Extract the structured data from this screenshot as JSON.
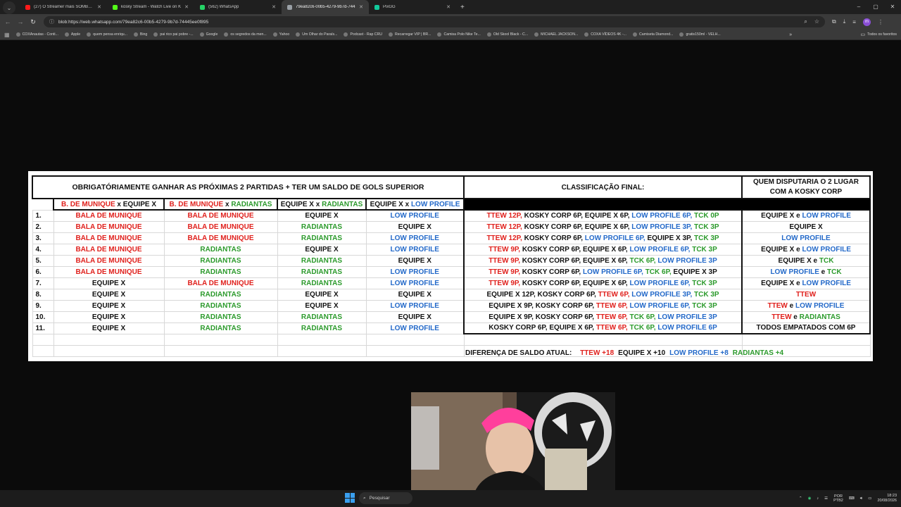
{
  "browser": {
    "tabs": [
      {
        "title": "(27) O Streamer mais SOMBRIO",
        "favicon_color": "#ff1a1a"
      },
      {
        "title": "kosky Stream - Watch Live on K",
        "favicon_color": "#53fc18"
      },
      {
        "title": "(562) WhatsApp",
        "favicon_color": "#25d366"
      },
      {
        "title": "79ea82c6-00b5-4279-9b7d-744",
        "favicon_color": "#9aa0a6",
        "active": true
      },
      {
        "title": "PixGG",
        "favicon_color": "#12c99b"
      }
    ],
    "address": "blob:https://web.whatsapp.com/79ea82c6-00b5-4279-9b7d-74445ee0f895",
    "profile_initial": "m",
    "bookmarks": [
      "COXAnautas - Conti...",
      "Apple",
      "quem pensa enriqu...",
      "Bing",
      "pai rico pai pobre -...",
      "Google",
      "os segredos da men...",
      "Yahoo",
      "Um Olhar do Paraís...",
      "Podcast - Rap CRU",
      "Recarregar VIP | BR...",
      "Camisa Polo Nike Te...",
      "Old Skool Black - C...",
      "MICHAEL JACKSON...",
      "COXA VÍDEOS 4K -...",
      "Camiseta Diamond...",
      "gratis150ml - VELH..."
    ],
    "all_bookmarks_label": "Todos os favoritos"
  },
  "sheet": {
    "header_main": "OBRIGATÓRIAMENTE GANHAR AS PRÓXIMAS 2 PARTIDAS + TER UM SALDO DE GOLS SUPERIOR",
    "header_class": "CLASSIFICAÇÃO FINAL:",
    "header_quem_line1": "QUEM DISPUTARIA O 2 LUGAR",
    "header_quem_line2": "COM A KOSKY CORP",
    "sub": [
      [
        {
          "t": "B. DE MUNIQUE",
          "c": "red"
        },
        {
          "t": " x ",
          "c": "blk"
        },
        {
          "t": "EQUIPE X",
          "c": "blk"
        }
      ],
      [
        {
          "t": "B. DE MUNIQUE",
          "c": "red"
        },
        {
          "t": " x ",
          "c": "blk"
        },
        {
          "t": "RADIANTAS",
          "c": "green"
        }
      ],
      [
        {
          "t": "EQUIPE X",
          "c": "blk"
        },
        {
          "t": " x ",
          "c": "blk"
        },
        {
          "t": "RADIANTAS",
          "c": "green"
        }
      ],
      [
        {
          "t": "EQUIPE X",
          "c": "blk"
        },
        {
          "t": " x ",
          "c": "blk"
        },
        {
          "t": "LOW PROFILE",
          "c": "blue"
        }
      ]
    ],
    "rows": [
      {
        "n": "1.",
        "m": [
          [
            "BALA DE MUNIQUE",
            "red"
          ],
          [
            "BALA DE MUNIQUE",
            "red"
          ],
          [
            "EQUIPE X",
            "blk"
          ],
          [
            "LOW PROFILE",
            "blue"
          ]
        ],
        "cls": [
          [
            "TTEW 12P,",
            "red"
          ],
          [
            " KOSKY CORP 6P, EQUIPE X 6P, ",
            "blk"
          ],
          [
            "LOW PROFILE 6P, ",
            "blue"
          ],
          [
            "TCK 0P",
            "green"
          ]
        ],
        "quem": [
          [
            "EQUIPE X ",
            "blk"
          ],
          [
            "e ",
            "blk"
          ],
          [
            "LOW PROFILE",
            "blue"
          ]
        ]
      },
      {
        "n": "2.",
        "m": [
          [
            "BALA DE MUNIQUE",
            "red"
          ],
          [
            "BALA DE MUNIQUE",
            "red"
          ],
          [
            "RADIANTAS",
            "green"
          ],
          [
            "EQUIPE X",
            "blk"
          ]
        ],
        "cls": [
          [
            "TTEW 12P,",
            "red"
          ],
          [
            " KOSKY CORP 6P, EQUIPE X 6P, ",
            "blk"
          ],
          [
            "LOW PROFILE 3P, ",
            "blue"
          ],
          [
            "TCK 3P",
            "green"
          ]
        ],
        "quem": [
          [
            "EQUIPE X",
            "blk"
          ]
        ]
      },
      {
        "n": "3.",
        "m": [
          [
            "BALA DE MUNIQUE",
            "red"
          ],
          [
            "BALA DE MUNIQUE",
            "red"
          ],
          [
            "RADIANTAS",
            "green"
          ],
          [
            "LOW PROFILE",
            "blue"
          ]
        ],
        "cls": [
          [
            "TTEW 12P,",
            "red"
          ],
          [
            " KOSKY CORP 6P, ",
            "blk"
          ],
          [
            "LOW PROFILE 6P,",
            "blue"
          ],
          [
            " EQUIPE X 3P, ",
            "blk"
          ],
          [
            "TCK 3P",
            "green"
          ]
        ],
        "quem": [
          [
            "LOW PROFILE",
            "blue"
          ]
        ]
      },
      {
        "n": "4.",
        "m": [
          [
            "BALA DE MUNIQUE",
            "red"
          ],
          [
            "RADIANTAS",
            "green"
          ],
          [
            "EQUIPE X",
            "blk"
          ],
          [
            "LOW PROFILE",
            "blue"
          ]
        ],
        "cls": [
          [
            "TTEW 9P,",
            "red"
          ],
          [
            " KOSKY CORP 6P, EQUIPE X 6P, ",
            "blk"
          ],
          [
            "LOW PROFILE 6P, ",
            "blue"
          ],
          [
            "TCK 3P",
            "green"
          ]
        ],
        "quem": [
          [
            "EQUIPE X ",
            "blk"
          ],
          [
            "e ",
            "blk"
          ],
          [
            "LOW PROFILE",
            "blue"
          ]
        ]
      },
      {
        "n": "5.",
        "m": [
          [
            "BALA DE MUNIQUE",
            "red"
          ],
          [
            "RADIANTAS",
            "green"
          ],
          [
            "RADIANTAS",
            "green"
          ],
          [
            "EQUIPE X",
            "blk"
          ]
        ],
        "cls": [
          [
            "TTEW 9P,",
            "red"
          ],
          [
            " KOSKY CORP 6P, EQUIPE X 6P, ",
            "blk"
          ],
          [
            "TCK 6P, ",
            "green"
          ],
          [
            "LOW PROFILE 3P",
            "blue"
          ]
        ],
        "quem": [
          [
            "EQUIPE X ",
            "blk"
          ],
          [
            "e ",
            "blk"
          ],
          [
            "TCK",
            "green"
          ]
        ]
      },
      {
        "n": "6.",
        "m": [
          [
            "BALA DE MUNIQUE",
            "red"
          ],
          [
            "RADIANTAS",
            "green"
          ],
          [
            "RADIANTAS",
            "green"
          ],
          [
            "LOW PROFILE",
            "blue"
          ]
        ],
        "cls": [
          [
            "TTEW 9P,",
            "red"
          ],
          [
            " KOSKY CORP 6P, ",
            "blk"
          ],
          [
            "LOW PROFILE 6P, ",
            "blue"
          ],
          [
            "TCK 6P,",
            "green"
          ],
          [
            " EQUIPE X 3P",
            "blk"
          ]
        ],
        "quem": [
          [
            "LOW PROFILE ",
            "blue"
          ],
          [
            "e ",
            "blk"
          ],
          [
            "TCK",
            "green"
          ]
        ]
      },
      {
        "n": "7.",
        "m": [
          [
            "EQUIPE X",
            "blk"
          ],
          [
            "BALA DE MUNIQUE",
            "red"
          ],
          [
            "RADIANTAS",
            "green"
          ],
          [
            "LOW PROFILE",
            "blue"
          ]
        ],
        "cls": [
          [
            "TTEW 9P,",
            "red"
          ],
          [
            " KOSKY CORP 6P, EQUIPE X 6P, ",
            "blk"
          ],
          [
            "LOW PROFILE 6P, ",
            "blue"
          ],
          [
            "TCK 3P",
            "green"
          ]
        ],
        "quem": [
          [
            "EQUIPE X ",
            "blk"
          ],
          [
            "e ",
            "blk"
          ],
          [
            "LOW PROFILE",
            "blue"
          ]
        ]
      },
      {
        "n": "8.",
        "m": [
          [
            "EQUIPE X",
            "blk"
          ],
          [
            "RADIANTAS",
            "green"
          ],
          [
            "EQUIPE X",
            "blk"
          ],
          [
            "EQUIPE X",
            "blk"
          ]
        ],
        "cls": [
          [
            "EQUIPE X 12P, KOSKY CORP 6P, ",
            "blk"
          ],
          [
            "TTEW 6P, ",
            "red"
          ],
          [
            "LOW PROFILE 3P, ",
            "blue"
          ],
          [
            "TCK 3P",
            "green"
          ]
        ],
        "quem": [
          [
            "TTEW",
            "red"
          ]
        ]
      },
      {
        "n": "9.",
        "m": [
          [
            "EQUIPE X",
            "blk"
          ],
          [
            "RADIANTAS",
            "green"
          ],
          [
            "EQUIPE X",
            "blk"
          ],
          [
            "LOW PROFILE",
            "blue"
          ]
        ],
        "cls": [
          [
            "EQUIPE X 9P, KOSKY CORP 6P, ",
            "blk"
          ],
          [
            "TTEW 6P, ",
            "red"
          ],
          [
            "LOW PROFILE 6P, ",
            "blue"
          ],
          [
            "TCK 3P",
            "green"
          ]
        ],
        "quem": [
          [
            "TTEW ",
            "red"
          ],
          [
            "e ",
            "blk"
          ],
          [
            "LOW PROFILE",
            "blue"
          ]
        ]
      },
      {
        "n": "10.",
        "m": [
          [
            "EQUIPE X",
            "blk"
          ],
          [
            "RADIANTAS",
            "green"
          ],
          [
            "RADIANTAS",
            "green"
          ],
          [
            "EQUIPE X",
            "blk"
          ]
        ],
        "cls": [
          [
            "EQUIPE X 9P, KOSKY CORP 6P, ",
            "blk"
          ],
          [
            "TTEW 6P, ",
            "red"
          ],
          [
            "TCK 6P, ",
            "green"
          ],
          [
            "LOW PROFILE 3P",
            "blue"
          ]
        ],
        "quem": [
          [
            "TTEW ",
            "red"
          ],
          [
            "e ",
            "blk"
          ],
          [
            "RADIANTAS",
            "green"
          ]
        ]
      },
      {
        "n": "11.",
        "m": [
          [
            "EQUIPE X",
            "blk"
          ],
          [
            "RADIANTAS",
            "green"
          ],
          [
            "RADIANTAS",
            "green"
          ],
          [
            "LOW PROFILE",
            "blue"
          ]
        ],
        "cls": [
          [
            "KOSKY CORP 6P, EQUIPE X 6P, ",
            "blk"
          ],
          [
            "TTEW 6P, ",
            "red"
          ],
          [
            "TCK 6P, ",
            "green"
          ],
          [
            "LOW PROFILE 6P",
            "blue"
          ]
        ],
        "quem": [
          [
            "TODOS EMPATADOS COM 6P",
            "blk"
          ]
        ]
      }
    ],
    "diff_label": "DIFERENÇA DE SALDO ATUAL:",
    "diff": [
      [
        "TTEW +18",
        "red"
      ],
      [
        "EQUIPE X +10",
        "blk"
      ],
      [
        "LOW PROFILE +8",
        "blue"
      ],
      [
        "RADIANTAS +4",
        "green"
      ]
    ]
  },
  "colors": {
    "red": "#e0201c",
    "blue": "#2369c9",
    "green": "#2b9a2b"
  },
  "taskbar": {
    "search_placeholder": "Pesquisar",
    "lang_line1": "POR",
    "lang_line2": "PTB2",
    "time": "18:23",
    "date": "20/08/2026"
  }
}
